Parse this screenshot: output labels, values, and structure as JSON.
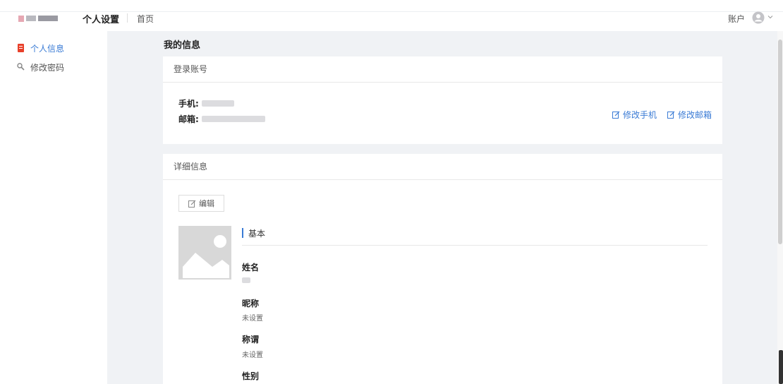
{
  "header": {
    "app_title": "个人设置",
    "home_link": "首页",
    "account_label": "账户"
  },
  "sidebar": {
    "items": [
      {
        "label": "个人信息",
        "icon": "document-icon",
        "active": true
      },
      {
        "label": "修改密码",
        "icon": "key-icon",
        "active": false
      }
    ],
    "collapse_label": "«"
  },
  "main": {
    "page_title": "我的信息",
    "login_card": {
      "title": "登录账号",
      "phone_label": "手机:",
      "email_label": "邮箱:",
      "edit_phone": "修改手机",
      "edit_email": "修改邮箱"
    },
    "detail_card": {
      "title": "详细信息",
      "edit_button": "编辑",
      "section_title": "基本",
      "fields": [
        {
          "label": "姓名",
          "value": ""
        },
        {
          "label": "昵称",
          "value": "未设置"
        },
        {
          "label": "称谓",
          "value": "未设置"
        },
        {
          "label": "性别",
          "value": ""
        }
      ]
    }
  },
  "colors": {
    "accent": "#3a7bd5",
    "background": "#f0f2f5"
  }
}
